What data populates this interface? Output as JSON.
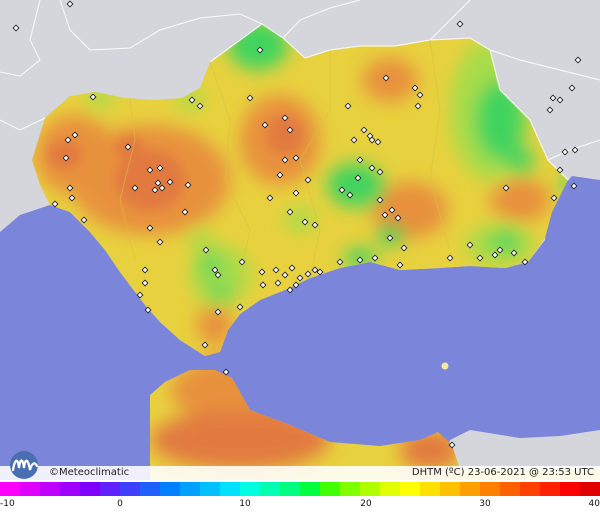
{
  "map": {
    "credit": "©Meteoclimatic",
    "caption": "DHTM (ºC)   23-06-2021 @ 23:53 UTC",
    "colors": {
      "sea": "#7b86db",
      "land_outside": "#d4d6dc",
      "region_base": "#e8d13e",
      "warm": "#e8913e",
      "hot": "#e27a3f",
      "cool": "#a7dc4a",
      "cold": "#3fd45f"
    }
  },
  "legend": {
    "ticks": [
      "-10",
      "0",
      "10",
      "20",
      "30",
      "40"
    ],
    "colors": [
      "#ff00ff",
      "#e000ff",
      "#c000ff",
      "#a000ff",
      "#8000ff",
      "#6020ff",
      "#4040ff",
      "#2060ff",
      "#0080ff",
      "#00a0ff",
      "#00c0ff",
      "#00e0ff",
      "#00ffe0",
      "#00ffb0",
      "#00ff80",
      "#00ff40",
      "#40ff00",
      "#80ff00",
      "#b0ff00",
      "#e0ff00",
      "#ffff00",
      "#ffe000",
      "#ffc000",
      "#ffa000",
      "#ff8000",
      "#ff6000",
      "#ff4000",
      "#ff2000",
      "#ff0000",
      "#e00000"
    ]
  }
}
